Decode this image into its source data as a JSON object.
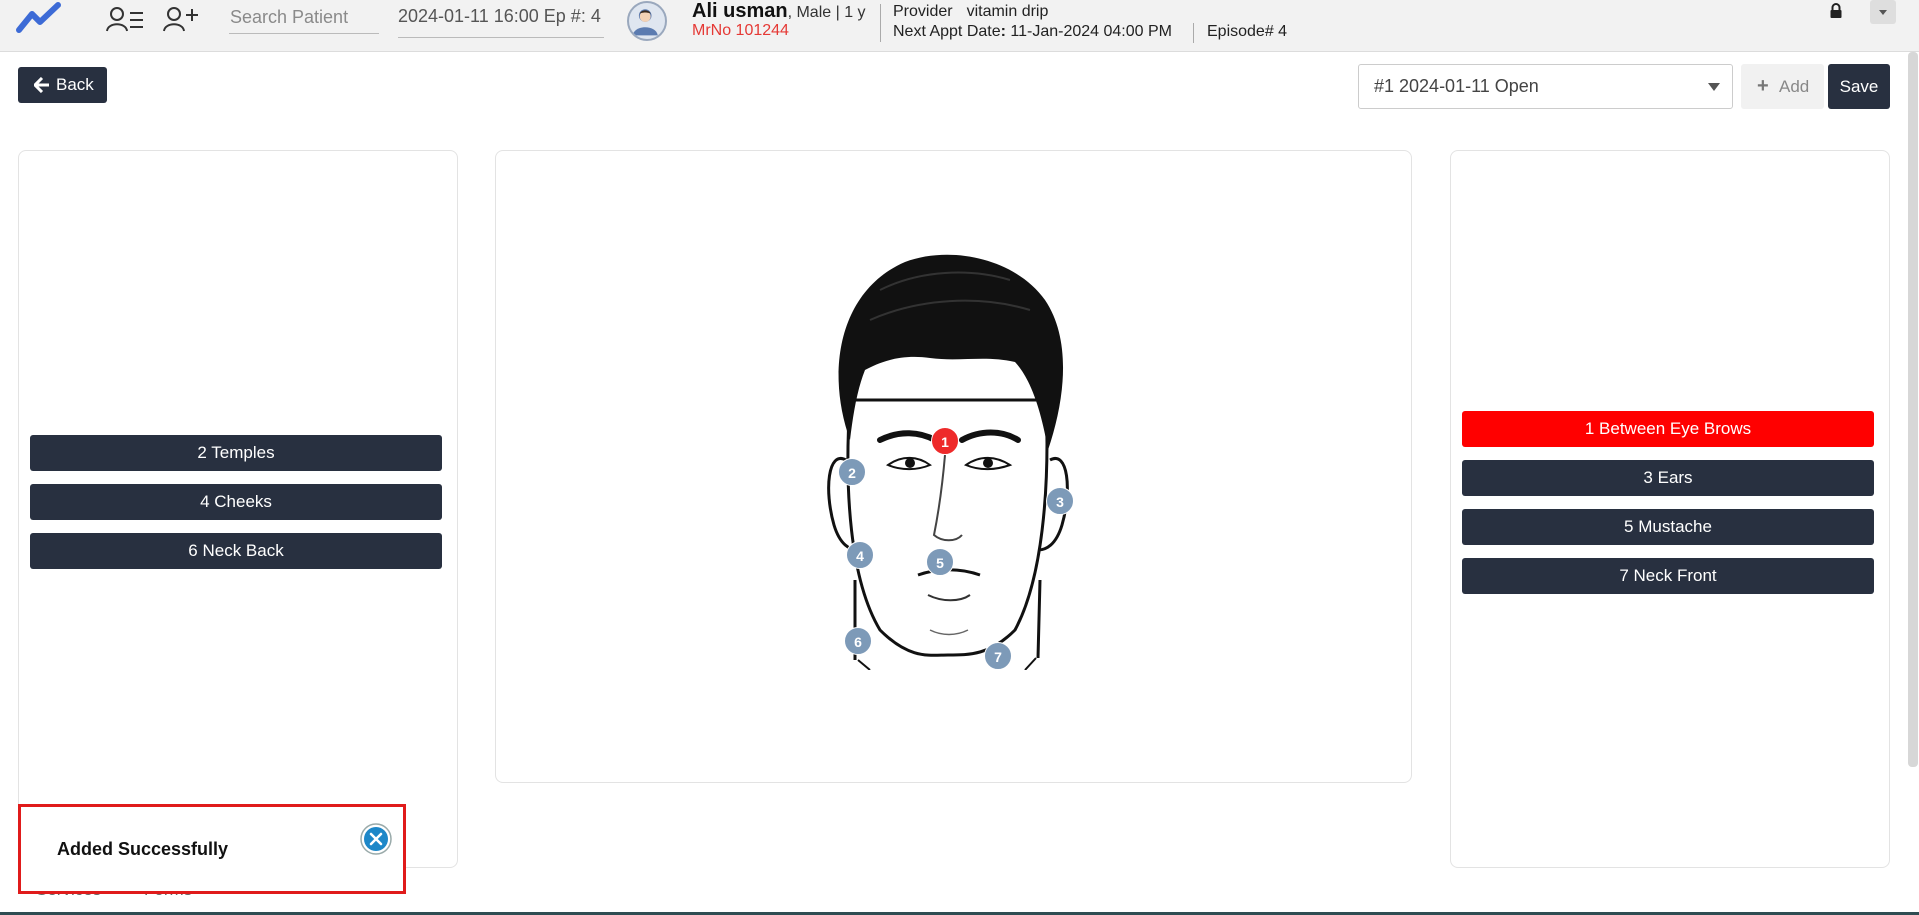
{
  "header": {
    "search_placeholder": "Search Patient",
    "episode_field": "2024-01-11 16:00 Ep #: 4",
    "patient_name": "Ali usman",
    "patient_details": ", Male | 1 y",
    "mrno": "MrNo 101244",
    "provider_label": "Provider",
    "provider_value": "vitamin drip",
    "next_appt_label": "Next Appt Date",
    "next_appt_value": "11-Jan-2024 04:00 PM",
    "episode_number": "Episode# 4"
  },
  "toolbar": {
    "back_label": "Back",
    "episode_select_value": "#1 2024-01-11 Open",
    "add_label": "Add",
    "save_label": "Save"
  },
  "left_regions": [
    {
      "label": "2 Temples"
    },
    {
      "label": "4 Cheeks"
    },
    {
      "label": "6 Neck Back"
    }
  ],
  "right_regions": [
    {
      "label": "1 Between Eye Brows",
      "selected": true
    },
    {
      "label": "3 Ears",
      "selected": false
    },
    {
      "label": "5 Mustache",
      "selected": false
    },
    {
      "label": "7 Neck Front",
      "selected": false
    }
  ],
  "face_markers": [
    "1",
    "2",
    "3",
    "4",
    "5",
    "6",
    "7"
  ],
  "bottom_tabs": [
    "Services",
    "Forms"
  ],
  "toast": {
    "message": "Added Successfully"
  },
  "colors": {
    "dark_button": "#283040",
    "selected_region": "#ff0000",
    "marker": "#7d9ab8",
    "active_marker": "#ee2a2a",
    "mrno": "#e53935",
    "toast_border": "#e01b1b"
  }
}
